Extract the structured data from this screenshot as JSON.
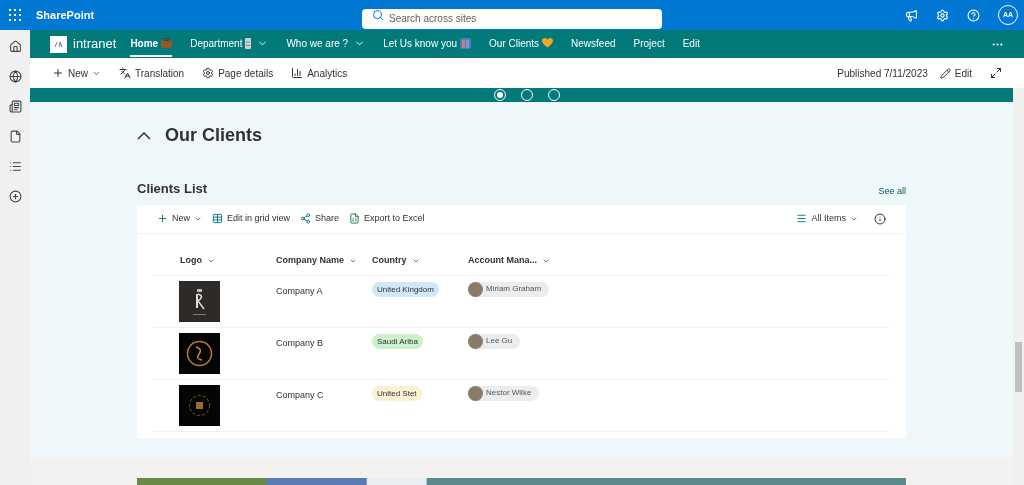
{
  "suite_bar": {
    "app_name": "SharePoint",
    "search": {
      "placeholder": "Search across sites"
    },
    "avatar_initials": "AA"
  },
  "site_nav": {
    "site_name": "intranet",
    "items": [
      {
        "label": "Home",
        "selected": true,
        "has_menu": false
      },
      {
        "label": "Department",
        "selected": false,
        "has_menu": true
      },
      {
        "label": "Who we are ?",
        "selected": false,
        "has_menu": true
      },
      {
        "label": "Let Us know you",
        "selected": false,
        "has_menu": false
      },
      {
        "label": "Our Clients",
        "selected": false,
        "has_menu": false
      },
      {
        "label": "Newsfeed",
        "selected": false,
        "has_menu": false
      },
      {
        "label": "Project",
        "selected": false,
        "has_menu": false
      },
      {
        "label": "Edit",
        "selected": false,
        "has_menu": false
      }
    ]
  },
  "command_bar": {
    "new": "New",
    "translation": "Translation",
    "page_details": "Page details",
    "analytics": "Analytics",
    "published": "Published 7/11/2023",
    "edit": "Edit"
  },
  "carousel": [
    {
      "selected": true
    },
    {
      "selected": false
    },
    {
      "selected": false
    }
  ],
  "section": {
    "title": "Our Clients",
    "expanded": true
  },
  "list": {
    "title": "Clients List",
    "see_all": "See all",
    "toolbar": {
      "new": "New",
      "grid": "Edit in grid view",
      "share": "Share",
      "export": "Export to Excel",
      "view": "All Items"
    },
    "columns": [
      "Logo",
      "Company Name",
      "Country",
      "Account Mana..."
    ],
    "rows": [
      {
        "company": "Company A",
        "country": "United Kingdom",
        "color": "#d0e7f8",
        "manager": "Miriam Graham"
      },
      {
        "company": "Company B",
        "country": "Saudi Ariba",
        "color": "#caf0cc",
        "manager": "Lee Gu"
      },
      {
        "company": "Company C",
        "country": "United Stet",
        "color": "#fcefd4",
        "manager": "Nestor Wilke"
      }
    ]
  }
}
